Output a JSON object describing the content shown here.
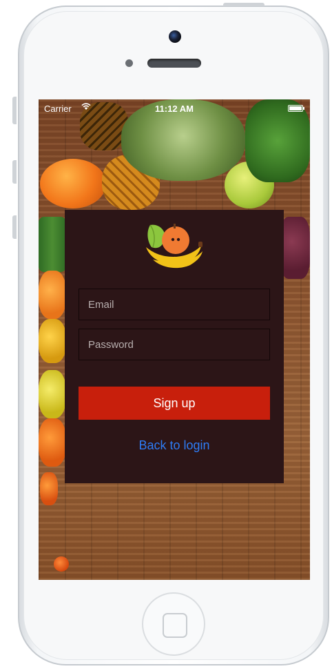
{
  "status_bar": {
    "carrier": "Carrier",
    "time": "11:12 AM",
    "wifi_icon": "wifi-icon",
    "battery_icon": "battery-icon"
  },
  "logo": {
    "icon": "fruit-basket-logo"
  },
  "form": {
    "email_placeholder": "Email",
    "email_value": "",
    "password_placeholder": "Password",
    "password_value": ""
  },
  "actions": {
    "signup_label": "Sign up",
    "back_label": "Back to login"
  },
  "colors": {
    "card_background": "#2c1517",
    "signup_button": "#c81f0c",
    "link": "#2e7cf6",
    "logo_yellow": "#f2c218",
    "logo_orange": "#f07a32",
    "logo_green": "#8cc63e"
  }
}
